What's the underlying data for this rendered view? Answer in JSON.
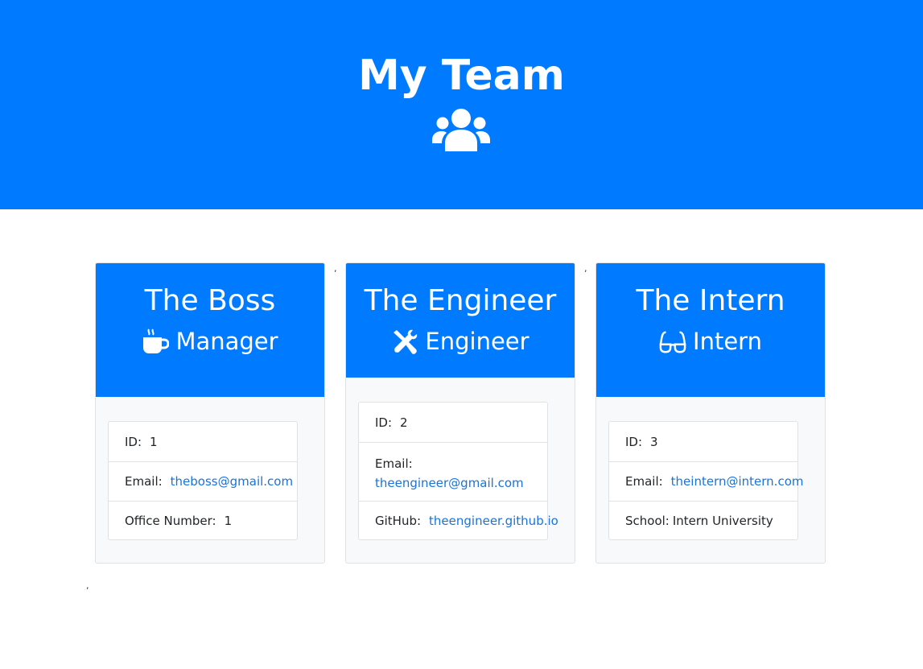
{
  "header": {
    "title": "My Team",
    "icon": "users-icon",
    "color": "#007bff"
  },
  "cards": [
    {
      "name": "The Boss",
      "role": "Manager",
      "role_icon": "mug-icon",
      "details": [
        {
          "label": "ID:",
          "value": "1"
        },
        {
          "label": "Email:",
          "value": "theboss@gmail.com"
        },
        {
          "label": "Office Number:",
          "value": "1"
        }
      ]
    },
    {
      "name": "The Engineer",
      "role": "Engineer",
      "role_icon": "tools-icon",
      "details": [
        {
          "label": "ID:",
          "value": "2"
        },
        {
          "label": "Email:",
          "value": "theengineer@gmail.com"
        },
        {
          "label": "GitHub:",
          "value": "theengineer.github.io"
        }
      ]
    },
    {
      "name": "The Intern",
      "role": "Intern",
      "role_icon": "glasses-icon",
      "details": [
        {
          "label": "ID:",
          "value": "3"
        },
        {
          "label": "Email:",
          "value": "theintern@intern.com"
        },
        {
          "label": "School:",
          "value": "Intern University"
        }
      ]
    }
  ],
  "stray_commas": [
    ",",
    ",",
    ","
  ]
}
